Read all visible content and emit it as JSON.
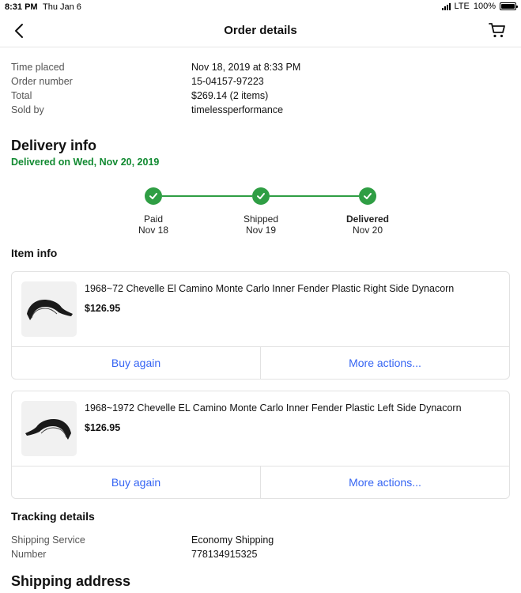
{
  "status_bar": {
    "time": "8:31 PM",
    "date": "Thu Jan 6",
    "carrier": "LTE",
    "battery": "100%"
  },
  "header": {
    "title": "Order details"
  },
  "summary": [
    {
      "label": "Time placed",
      "value": "Nov 18, 2019 at 8:33 PM"
    },
    {
      "label": "Order number",
      "value": "15-04157-97223"
    },
    {
      "label": "Total",
      "value": "$269.14 (2 items)"
    },
    {
      "label": "Sold by",
      "value": "timelessperformance"
    }
  ],
  "delivery": {
    "title": "Delivery info",
    "status": "Delivered on Wed, Nov 20, 2019",
    "steps": [
      {
        "name": "Paid",
        "date": "Nov 18"
      },
      {
        "name": "Shipped",
        "date": "Nov 19"
      },
      {
        "name": "Delivered",
        "date": "Nov 20"
      }
    ]
  },
  "items": {
    "title": "Item info",
    "list": [
      {
        "name": "1968~72 Chevelle El Camino Monte Carlo Inner Fender Plastic Right Side Dynacorn",
        "price": "$126.95",
        "buy_again": "Buy again",
        "more_actions": "More actions..."
      },
      {
        "name": "1968~1972 Chevelle EL Camino Monte Carlo Inner Fender Plastic Left Side Dynacorn",
        "price": "$126.95",
        "buy_again": "Buy again",
        "more_actions": "More actions..."
      }
    ]
  },
  "tracking": {
    "title": "Tracking details",
    "rows": [
      {
        "label": "Shipping Service",
        "value": "Economy Shipping"
      },
      {
        "label": "Number",
        "value": "778134915325"
      }
    ]
  },
  "shipping_address": {
    "title": "Shipping address"
  },
  "colors": {
    "accent": "#3665f3",
    "success": "#118a31",
    "progress": "#2f9e44"
  },
  "icons": {
    "back": "chevron-left-icon",
    "cart": "cart-icon",
    "step": "check-circle-icon"
  }
}
